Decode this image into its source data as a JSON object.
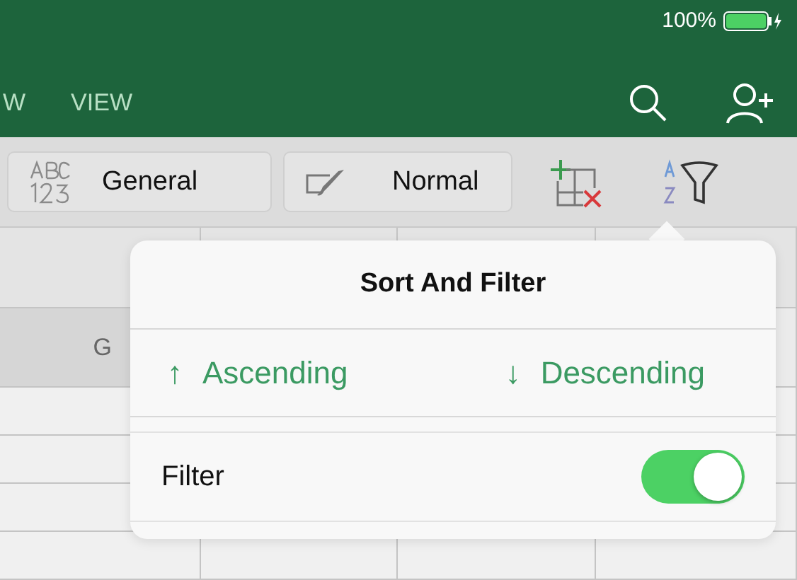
{
  "status_bar": {
    "battery": "100%"
  },
  "ribbon": {
    "tabs": [
      {
        "label": "W",
        "selected": false
      },
      {
        "label": "VIEW",
        "selected": false
      }
    ]
  },
  "toolbar": {
    "number_format": "General",
    "cell_style": "Normal"
  },
  "sheet": {
    "column_header": "G"
  },
  "popover": {
    "title": "Sort And Filter",
    "sort_options": [
      {
        "arrow": "↑",
        "label": "Ascending"
      },
      {
        "arrow": "↓",
        "label": "Descending"
      }
    ],
    "filter": {
      "label": "Filter",
      "on": true
    }
  }
}
